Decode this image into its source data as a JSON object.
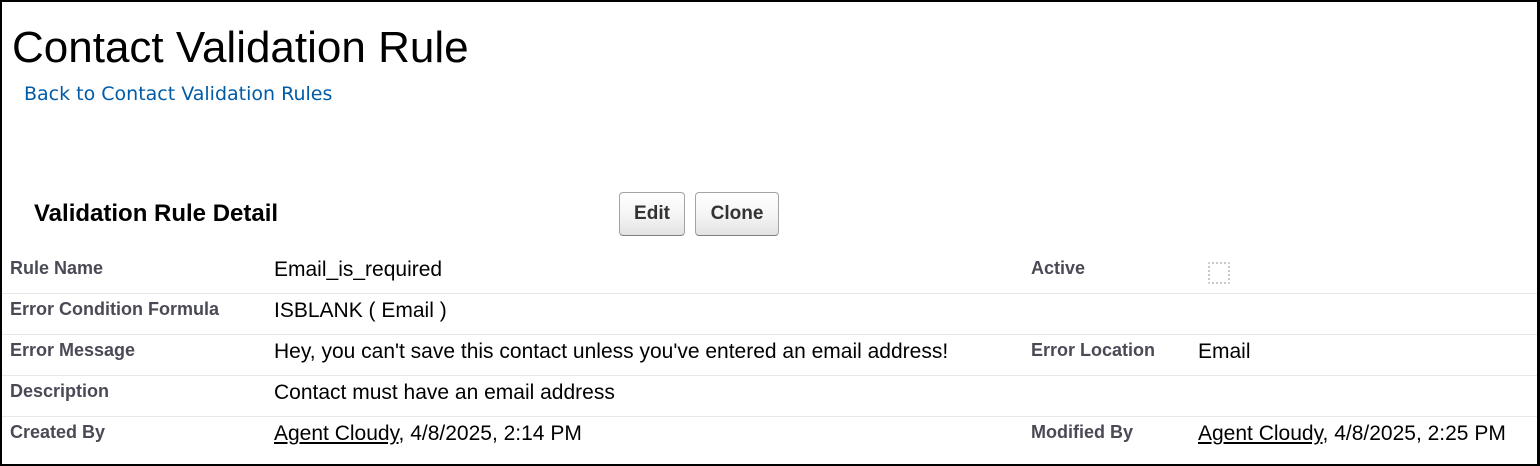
{
  "header": {
    "title": "Contact Validation Rule",
    "back_link": "Back to Contact Validation Rules"
  },
  "detail": {
    "section_title": "Validation Rule Detail",
    "buttons": {
      "edit": "Edit",
      "clone": "Clone"
    },
    "fields": {
      "rule_name": {
        "label": "Rule Name",
        "value": "Email_is_required"
      },
      "active": {
        "label": "Active",
        "checked": false
      },
      "error_condition_formula": {
        "label": "Error Condition Formula",
        "value": "ISBLANK ( Email )"
      },
      "error_message": {
        "label": "Error Message",
        "value": "Hey, you can't save this contact unless you've entered an email address!"
      },
      "error_location": {
        "label": "Error Location",
        "value": "Email"
      },
      "description": {
        "label": "Description",
        "value": "Contact must have an email address"
      },
      "created_by": {
        "label": "Created By",
        "user": "Agent Cloudy",
        "date": ", 4/8/2025, 2:14 PM"
      },
      "modified_by": {
        "label": "Modified By",
        "user": "Agent Cloudy",
        "date": ", 4/8/2025, 2:25 PM"
      }
    }
  },
  "colors": {
    "link": "#015ba7",
    "label": "#4a4a56",
    "row_divider": "#e8e8e8"
  }
}
